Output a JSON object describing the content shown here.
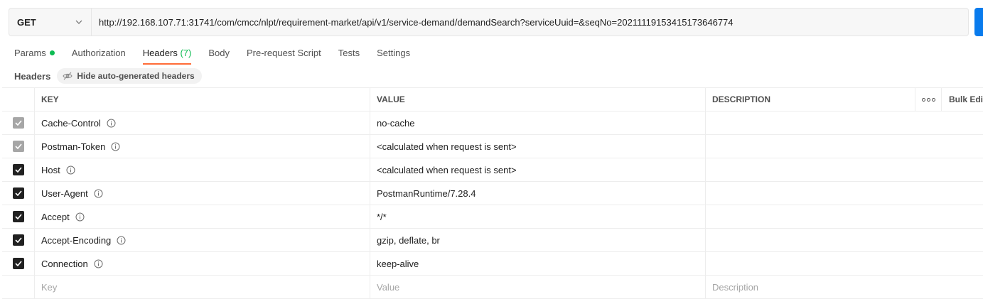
{
  "request": {
    "method": "GET",
    "url": "http://192.168.107.71:31741/com/cmcc/nlpt/requirement-market/api/v1/service-demand/demandSearch?serviceUuid=&seqNo=20211119153415173646774"
  },
  "tabs": [
    {
      "label": "Params",
      "dot": true
    },
    {
      "label": "Authorization"
    },
    {
      "label": "Headers",
      "count": "(7)",
      "active": true
    },
    {
      "label": "Body"
    },
    {
      "label": "Pre-request Script"
    },
    {
      "label": "Tests"
    },
    {
      "label": "Settings"
    }
  ],
  "headers_section": {
    "title": "Headers",
    "hide_button": "Hide auto-generated headers"
  },
  "table": {
    "columns": {
      "key": "KEY",
      "value": "VALUE",
      "description": "DESCRIPTION",
      "bulk_edit": "Bulk Edit"
    },
    "rows": [
      {
        "key": "Cache-Control",
        "value": "no-cache",
        "checked": true,
        "auto": true
      },
      {
        "key": "Postman-Token",
        "value": "<calculated when request is sent>",
        "checked": true,
        "auto": true
      },
      {
        "key": "Host",
        "value": "<calculated when request is sent>",
        "checked": true,
        "auto": false
      },
      {
        "key": "User-Agent",
        "value": "PostmanRuntime/7.28.4",
        "checked": true,
        "auto": false
      },
      {
        "key": "Accept",
        "value": "*/*",
        "checked": true,
        "auto": false
      },
      {
        "key": "Accept-Encoding",
        "value": "gzip, deflate, br",
        "checked": true,
        "auto": false
      },
      {
        "key": "Connection",
        "value": "keep-alive",
        "checked": true,
        "auto": false
      }
    ],
    "placeholders": {
      "key": "Key",
      "value": "Value",
      "description": "Description"
    }
  },
  "colors": {
    "accent": "#ff6c37",
    "green": "#0cbb52",
    "send": "#097bed"
  }
}
